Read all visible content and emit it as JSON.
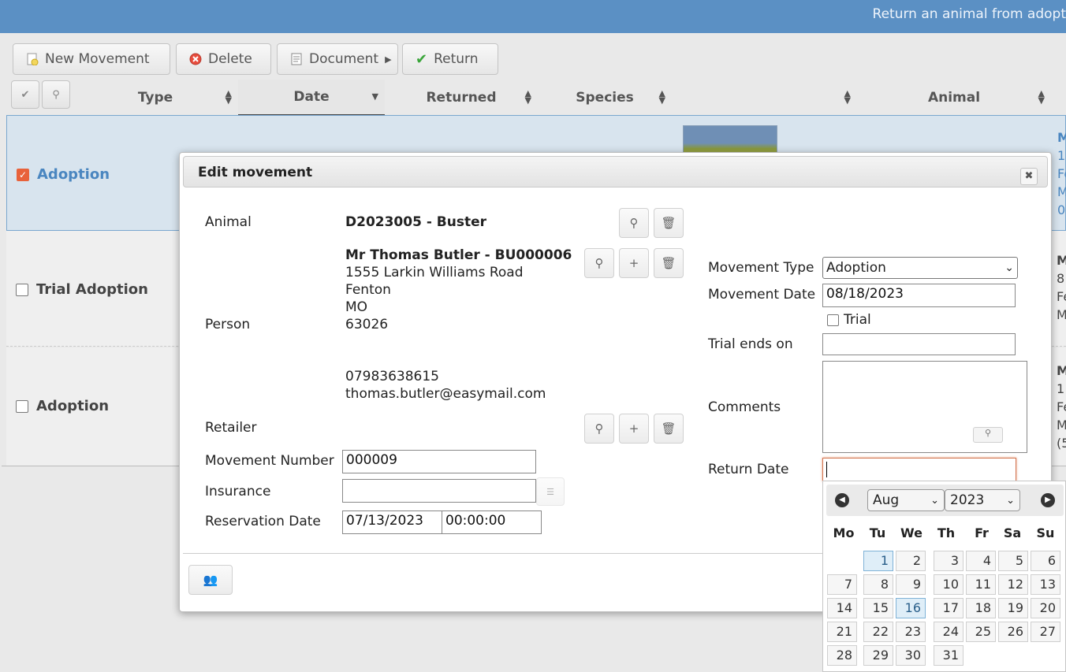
{
  "topbar": {
    "title": "Return an animal from adopt"
  },
  "toolbar": {
    "new_movement": "New Movement",
    "delete": "Delete",
    "document": "Document",
    "return": "Return"
  },
  "table": {
    "headers": {
      "type": "Type",
      "date": "Date",
      "returned": "Returned",
      "species": "Species",
      "blank": "",
      "animal": "Animal"
    },
    "rows": [
      {
        "type": "Adoption",
        "checked": true,
        "right_lines": [
          "M",
          "1",
          "Fe",
          "M",
          "0"
        ]
      },
      {
        "type": "Trial Adoption",
        "checked": false,
        "right_lines": [
          "M",
          "8",
          "Fe",
          "M"
        ]
      },
      {
        "type": "Adoption",
        "checked": false,
        "right_lines": [
          "M",
          "1",
          "Fe",
          "M",
          "(5"
        ]
      }
    ]
  },
  "dialog": {
    "title": "Edit movement",
    "animal_label": "Animal",
    "animal_value": "D2023005 - Buster",
    "person_label": "Person",
    "person_name": "Mr Thomas Butler - BU000006",
    "person_addr1": "1555 Larkin Williams Road",
    "person_addr2": "Fenton",
    "person_addr3": "MO",
    "person_addr4": "63026",
    "person_phone": "07983638615",
    "person_email": "thomas.butler@easymail.com",
    "retailer_label": "Retailer",
    "movement_number_label": "Movement Number",
    "movement_number_value": "000009",
    "insurance_label": "Insurance",
    "insurance_value": "",
    "reservation_label": "Reservation Date",
    "reservation_date": "07/13/2023",
    "reservation_time": "00:00:00",
    "movement_type_label": "Movement Type",
    "movement_type_value": "Adoption",
    "movement_date_label": "Movement Date",
    "movement_date_value": "08/18/2023",
    "trial_label": "Trial",
    "trial_ends_label": "Trial ends on",
    "comments_label": "Comments",
    "return_date_label": "Return Date"
  },
  "calendar": {
    "month": "Aug",
    "year": "2023",
    "dow": [
      "Mo",
      "Tu",
      "We",
      "Th",
      "Fr",
      "Sa",
      "Su"
    ],
    "days": [
      "1",
      "2",
      "3",
      "4",
      "5",
      "6",
      "7",
      "8",
      "9",
      "10",
      "11",
      "12",
      "13",
      "14",
      "15",
      "16",
      "17",
      "18",
      "19",
      "20",
      "21",
      "22",
      "23",
      "24",
      "25",
      "26",
      "27",
      "28",
      "29",
      "30",
      "31"
    ],
    "highlighted": [
      "1",
      "16"
    ]
  }
}
